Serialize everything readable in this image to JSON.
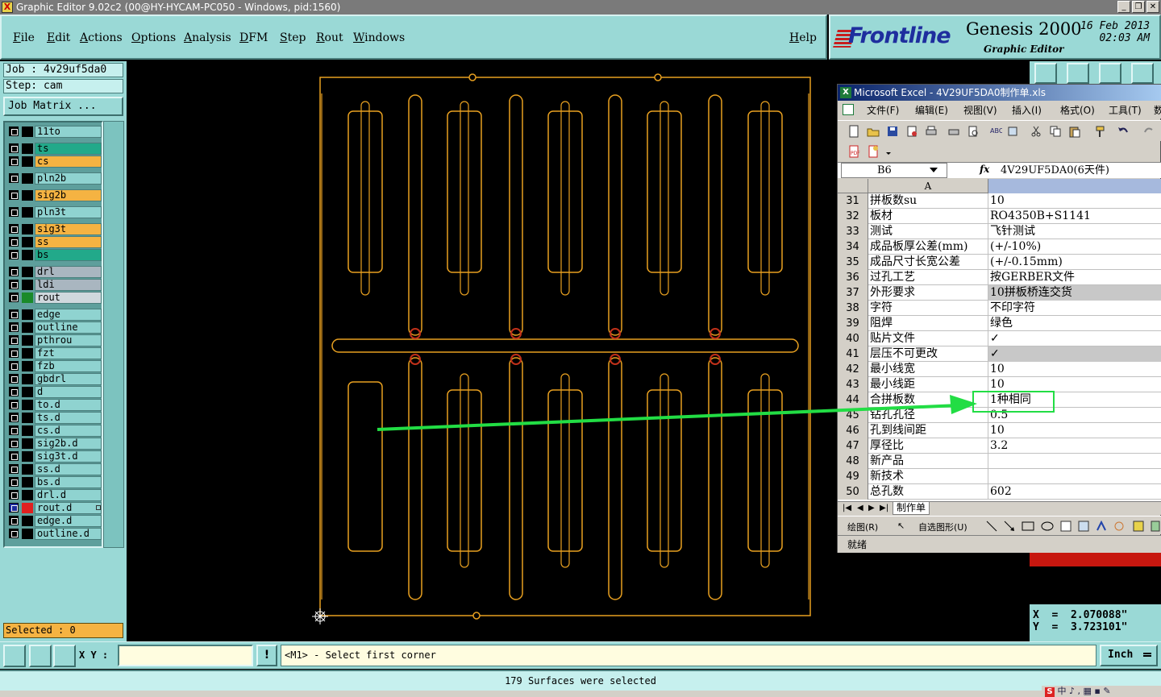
{
  "window": {
    "title": "Graphic Editor 9.02c2 (00@HY-HYCAM-PC050 - Windows, pid:1560)",
    "app_icon": "X",
    "controls": [
      "_",
      "❐",
      "✕"
    ]
  },
  "menubar": {
    "items": [
      "File",
      "Edit",
      "Actions",
      "Options",
      "Analysis",
      "DFM",
      "Step",
      "Rout",
      "Windows"
    ],
    "help": "Help"
  },
  "brand": {
    "logo": "Frontline",
    "product": "Genesis 2000",
    "subtitle": "Graphic Editor",
    "date": "16 Feb 2013",
    "time": "02:03 AM"
  },
  "job_panel": {
    "job": "Job : 4v29uf5da0",
    "step": "Step: cam",
    "job_matrix_button": "Job Matrix ..."
  },
  "layers": [
    {
      "name": "11to",
      "color": "default"
    },
    {
      "name": "ts",
      "color": "green"
    },
    {
      "name": "cs",
      "color": "orange"
    },
    {
      "name": "pln2b",
      "color": "default"
    },
    {
      "name": "sig2b",
      "color": "orange"
    },
    {
      "name": "pln3t",
      "color": "default"
    },
    {
      "name": "sig3t",
      "color": "orange"
    },
    {
      "name": "ss",
      "color": "orange"
    },
    {
      "name": "bs",
      "color": "green"
    },
    {
      "name": "drl",
      "color": "gray"
    },
    {
      "name": "ldi",
      "color": "gray"
    },
    {
      "name": "rout",
      "color": "light"
    },
    {
      "name": "edge",
      "color": "default"
    },
    {
      "name": "outline",
      "color": "default"
    },
    {
      "name": "pthrou",
      "color": "default"
    },
    {
      "name": "fzt",
      "color": "default"
    },
    {
      "name": "fzb",
      "color": "default"
    },
    {
      "name": "gbdrl",
      "color": "default"
    },
    {
      "name": "d",
      "color": "default"
    },
    {
      "name": "to.d",
      "color": "default"
    },
    {
      "name": "ts.d",
      "color": "default"
    },
    {
      "name": "cs.d",
      "color": "default"
    },
    {
      "name": "sig2b.d",
      "color": "default"
    },
    {
      "name": "sig3t.d",
      "color": "default"
    },
    {
      "name": "ss.d",
      "color": "default"
    },
    {
      "name": "bs.d",
      "color": "default"
    },
    {
      "name": "drl.d",
      "color": "default"
    },
    {
      "name": "rout.d",
      "color": "default"
    },
    {
      "name": "edge.d",
      "color": "default"
    },
    {
      "name": "outline.d",
      "color": "default"
    }
  ],
  "selected_count": "Selected : 0",
  "coords": {
    "x": "X  =  2.070088\"",
    "y": "Y  =  3.723101\""
  },
  "bottom": {
    "xy_label": "X Y :",
    "xy_value": "",
    "excl": "!",
    "prompt": "<M1> - Select first corner",
    "unit": "Inch"
  },
  "status": "179 Surfaces were selected",
  "excel": {
    "title": "Microsoft Excel - 4V29UF5DA0制作单.xls",
    "menu": [
      "文件(F)",
      "编辑(E)",
      "视图(V)",
      "插入(I)",
      "格式(O)",
      "工具(T)",
      "数"
    ],
    "name_box": "B6",
    "fx": "fx",
    "formula": "4V29UF5DA0(6天件)",
    "column_a": "A",
    "rows": [
      {
        "num": "31",
        "a": "拼板数su",
        "b": "10"
      },
      {
        "num": "32",
        "a": "板材",
        "b": "RO4350B+S1141"
      },
      {
        "num": "33",
        "a": "测试",
        "b": "飞针测试"
      },
      {
        "num": "34",
        "a": "成品板厚公差(mm)",
        "b": "(+/-10%)"
      },
      {
        "num": "35",
        "a": "成品尺寸长宽公差",
        "b": "(+/-0.15mm)"
      },
      {
        "num": "36",
        "a": "过孔工艺",
        "b": "按GERBER文件"
      },
      {
        "num": "37",
        "a": "外形要求",
        "b": "10拼板桥连交货",
        "shaded": true
      },
      {
        "num": "38",
        "a": "字符",
        "b": "不印字符"
      },
      {
        "num": "39",
        "a": "阻焊",
        "b": "绿色"
      },
      {
        "num": "40",
        "a": "贴片文件",
        "b": "✓"
      },
      {
        "num": "41",
        "a": "层压不可更改",
        "b": "✓",
        "shaded": true
      },
      {
        "num": "42",
        "a": "最小线宽",
        "b": "10"
      },
      {
        "num": "43",
        "a": "最小线距",
        "b": "10"
      },
      {
        "num": "44",
        "a": "合拼板数",
        "b": "1种相同"
      },
      {
        "num": "45",
        "a": "钻孔孔径",
        "b": "0.5"
      },
      {
        "num": "46",
        "a": "孔到线间距",
        "b": "10"
      },
      {
        "num": "47",
        "a": "厚径比",
        "b": "3.2"
      },
      {
        "num": "48",
        "a": "新产品",
        "b": ""
      },
      {
        "num": "49",
        "a": "新技术",
        "b": ""
      },
      {
        "num": "50",
        "a": "总孔数",
        "b": "602"
      }
    ],
    "sheet_tab": "制作单",
    "draw_label": "绘图(R)",
    "autoshape_label": "自选图形(U)",
    "status": "就绪"
  },
  "tray_text": "中 ♪ , ▦ ▪ ✎",
  "colors": {
    "rout_outline": "#e8a020",
    "highlight": "#22dd44",
    "panel": "#9ad9d6"
  }
}
